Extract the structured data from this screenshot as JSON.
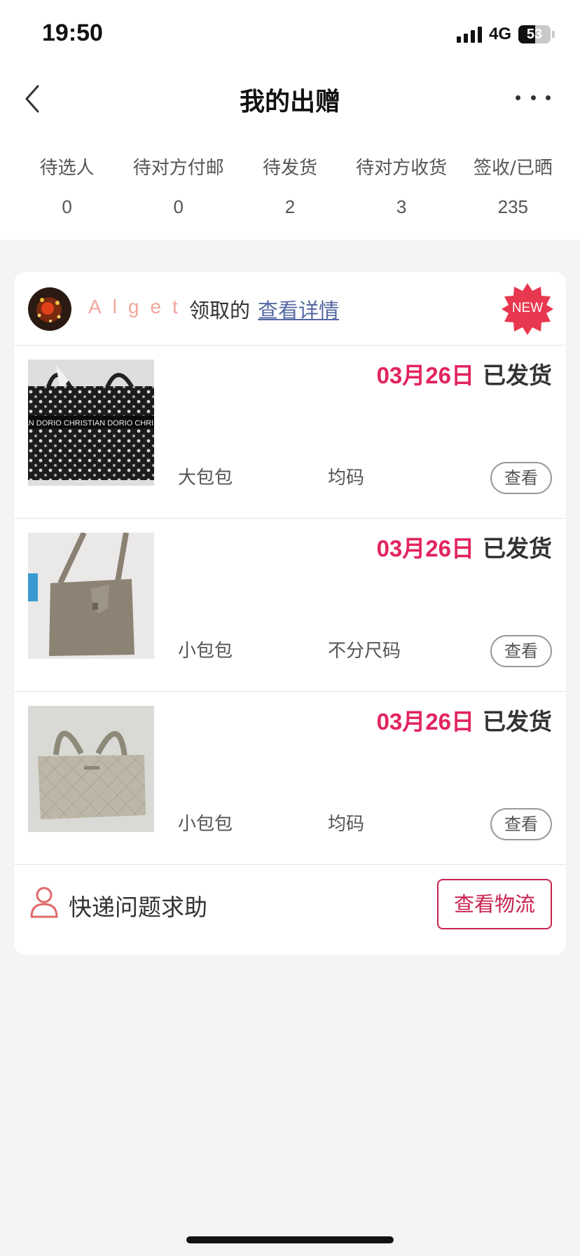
{
  "status_bar": {
    "time": "19:50",
    "network": "4G",
    "battery": "53",
    "battery_level_percent": 53
  },
  "header": {
    "title": "我的出赠",
    "back_icon": "chevron-left-icon",
    "more_icon": "more-dots-icon"
  },
  "tabs": [
    {
      "label": "待选人",
      "count": "0",
      "active": false
    },
    {
      "label": "待对方付邮",
      "count": "0",
      "active": false
    },
    {
      "label": "待发货",
      "count": "2",
      "active": false
    },
    {
      "label": "待对方收货",
      "count": "3",
      "active": true
    },
    {
      "label": "签收/已晒",
      "count": "235",
      "active": false
    }
  ],
  "order": {
    "recipient": "Alget",
    "claimed_text": "领取的",
    "detail_link": "查看详情",
    "badge": "NEW",
    "items": [
      {
        "date": "03月26日",
        "state": "已发货",
        "name": "大包包",
        "size": "均码",
        "view_label": "查看"
      },
      {
        "date": "03月26日",
        "state": "已发货",
        "name": "小包包",
        "size": "不分尺码",
        "view_label": "查看"
      },
      {
        "date": "03月26日",
        "state": "已发货",
        "name": "小包包",
        "size": "均码",
        "view_label": "查看"
      }
    ],
    "help_text": "快递问题求助",
    "logistics_button": "查看物流"
  },
  "colors": {
    "accent": "#e2245f",
    "link": "#5468a3",
    "username": "#f0a79a",
    "background": "#f4f4f4"
  }
}
